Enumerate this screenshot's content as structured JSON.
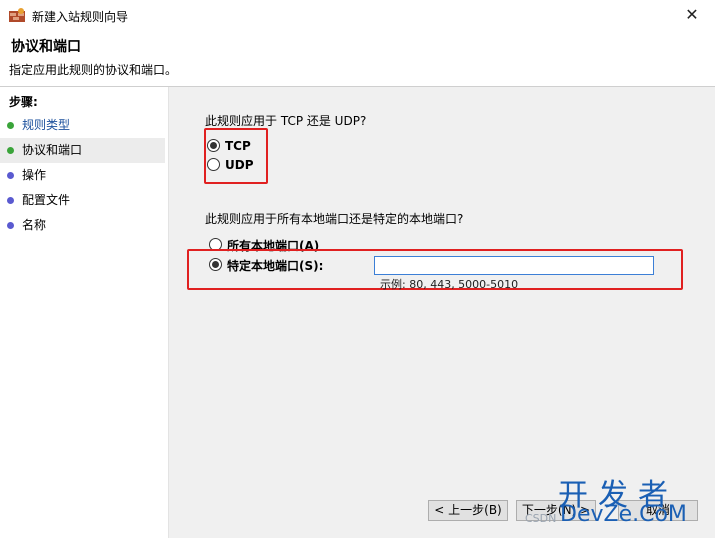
{
  "window": {
    "title": "新建入站规则向导",
    "close_glyph": "✕"
  },
  "header": {
    "title": "协议和端口",
    "subtitle": "指定应用此规则的协议和端口。"
  },
  "sidebar": {
    "steps_label": "步骤:",
    "items": [
      {
        "label": "规则类型",
        "dot_color": "#3aa43a"
      },
      {
        "label": "协议和端口",
        "dot_color": "#3aa43a"
      },
      {
        "label": "操作",
        "dot_color": "#5a5ad0"
      },
      {
        "label": "配置文件",
        "dot_color": "#5a5ad0"
      },
      {
        "label": "名称",
        "dot_color": "#5a5ad0"
      }
    ]
  },
  "main": {
    "protocol_question": "此规则应用于 TCP 还是 UDP?",
    "protocol_options": [
      {
        "label": "TCP",
        "selected": true
      },
      {
        "label": "UDP",
        "selected": false
      }
    ],
    "port_question": "此规则应用于所有本地端口还是特定的本地端口?",
    "port_options": [
      {
        "label": "所有本地端口(A)",
        "selected": false
      },
      {
        "label": "特定本地端口(S):",
        "selected": true
      }
    ],
    "port_input_value": "",
    "port_example": "示例: 80, 443, 5000-5010"
  },
  "buttons": {
    "back": "< 上一步(B)",
    "next": "下一步(N) >",
    "cancel": "取消"
  },
  "watermark": {
    "line1": "开发者",
    "line2": "DevZe.CoM",
    "line3": "CSDN"
  },
  "colors": {
    "highlight_box": "#e02020",
    "input_border": "#3c7fd6"
  }
}
